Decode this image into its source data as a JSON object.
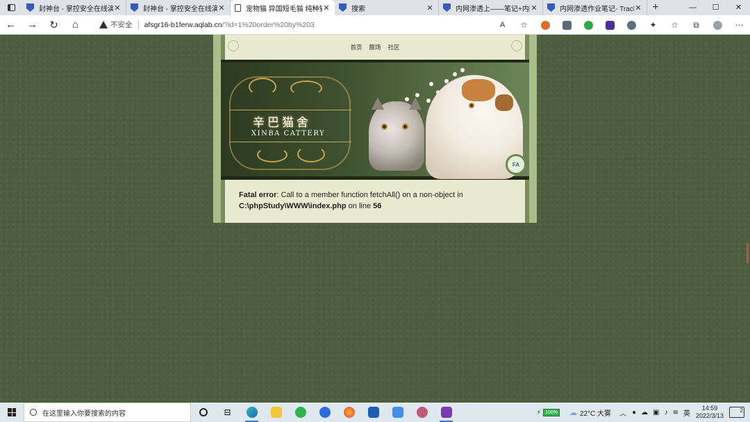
{
  "browser": {
    "tabs": [
      {
        "title": "封神台 - 掌控安全在线演练",
        "icon": "shield-icon"
      },
      {
        "title": "封神台 - 掌控安全在线演练",
        "icon": "shield-icon"
      },
      {
        "title": "宠物猫 异国短毛猫 纯种猫",
        "icon": "document-icon",
        "active": true
      },
      {
        "title": "搜索",
        "icon": "shield-icon"
      },
      {
        "title": "内网渗透上——笔记+内网",
        "icon": "shield-icon"
      },
      {
        "title": "内网渗透作业笔记- Track 知",
        "icon": "shield-icon"
      }
    ],
    "security_label": "不安全",
    "url_host": "afsgr16-b1ferw.aqlab.cn",
    "url_path": "/?id=1%20order%20by%203",
    "text_size_label": "A"
  },
  "site": {
    "nav": [
      "首页",
      "靓场",
      "社区"
    ],
    "logo_cn": "辛巴猫舍",
    "logo_en": "XINBA CATTERY",
    "badge": "FA",
    "error": {
      "label": "Fatal error",
      "message": ": Call to a member function fetchAll() on a non-object in",
      "path": "C:\\phpStudy\\WWW\\index.php",
      "on_line": "on line",
      "line": "56"
    }
  },
  "taskbar": {
    "search_placeholder": "在这里输入你要搜索的内容",
    "battery": "100%",
    "weather": "22°C 大雾",
    "ime": "英",
    "time": "14:59",
    "date": "2022/3/13",
    "notifications": "2"
  },
  "colors": {
    "page_bg": "#4e5f40",
    "site_frame": "#a9bf8a",
    "content_bg": "#e9ebd0",
    "gold": "#c9a44d"
  }
}
